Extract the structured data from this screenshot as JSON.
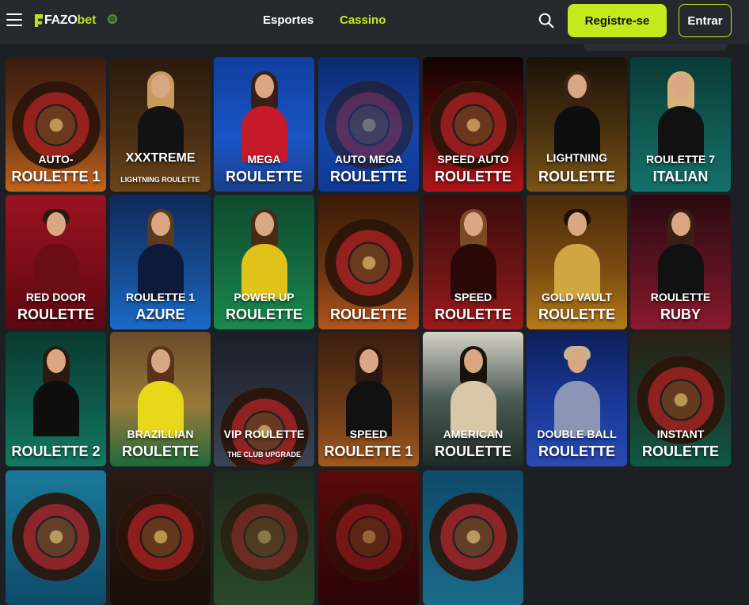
{
  "header": {
    "logo_fazo": "FAZO",
    "logo_bet": "bet",
    "nav_sports": "Esportes",
    "nav_casino": "Cassino",
    "register_label": "Registre-se",
    "login_label": "Entrar"
  },
  "colors": {
    "accent": "#c3ea1c",
    "topbar": "#24292e",
    "background": "#1c2024"
  },
  "games": [
    {
      "line1": "AUTO-",
      "line2": "ROULETTE 1"
    },
    {
      "line1": "XXXTREME",
      "line2": "LIGHTNING ROULETTE"
    },
    {
      "line1": "MEGA",
      "line2": "ROULETTE"
    },
    {
      "line1": "AUTO MEGA",
      "line2": "ROULETTE"
    },
    {
      "line1": "SPEED AUTO",
      "line2": "ROULETTE"
    },
    {
      "line1": "LIGHTNING",
      "line2": "ROULETTE"
    },
    {
      "line1": "ROULETTE 7",
      "line2": "ITALIAN"
    },
    {
      "line1": "RED DOOR",
      "line2": "ROULETTE"
    },
    {
      "line1": "ROULETTE 1",
      "line2": "AZURE"
    },
    {
      "line1": "POWER UP",
      "line2": "ROULETTE"
    },
    {
      "line1": "",
      "line2": "ROULETTE"
    },
    {
      "line1": "SPEED",
      "line2": "ROULETTE"
    },
    {
      "line1": "GOLD VAULT",
      "line2": "ROULETTE"
    },
    {
      "line1": "ROULETTE",
      "line2": "RUBY"
    },
    {
      "line1": "",
      "line2": "ROULETTE 2"
    },
    {
      "line1": "BRAZILLIAN",
      "line2": "ROULETTE"
    },
    {
      "line1": "VIP ROULETTE",
      "line2": "THE CLUB UPGRADE"
    },
    {
      "line1": "SPEED",
      "line2": "ROULETTE 1"
    },
    {
      "line1": "AMERICAN",
      "line2": "ROULETTE"
    },
    {
      "line1": "DOUBLE BALL",
      "line2": "ROULETTE"
    },
    {
      "line1": "INSTANT",
      "line2": "ROULETTE"
    },
    {
      "line1": "",
      "line2": ""
    },
    {
      "line1": "",
      "line2": ""
    },
    {
      "line1": "",
      "line2": ""
    },
    {
      "line1": "",
      "line2": ""
    },
    {
      "line1": "",
      "line2": ""
    }
  ]
}
